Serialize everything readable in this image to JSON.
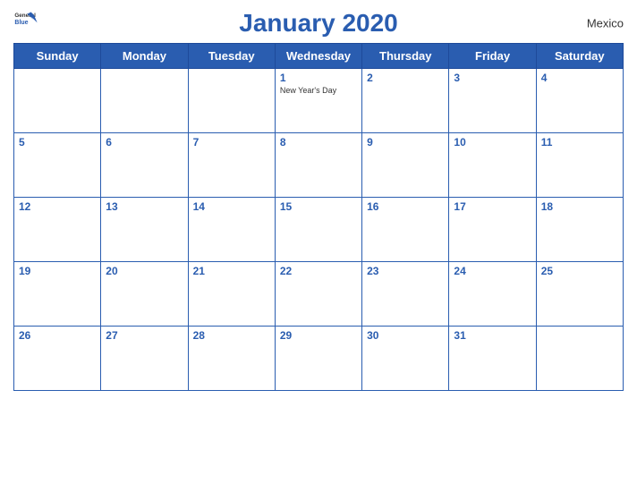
{
  "header": {
    "title": "January 2020",
    "country": "Mexico",
    "logo": {
      "line1": "General",
      "line2": "Blue"
    }
  },
  "weekdays": [
    "Sunday",
    "Monday",
    "Tuesday",
    "Wednesday",
    "Thursday",
    "Friday",
    "Saturday"
  ],
  "weeks": [
    [
      {
        "day": "",
        "holiday": ""
      },
      {
        "day": "",
        "holiday": ""
      },
      {
        "day": "",
        "holiday": ""
      },
      {
        "day": "1",
        "holiday": "New Year's Day"
      },
      {
        "day": "2",
        "holiday": ""
      },
      {
        "day": "3",
        "holiday": ""
      },
      {
        "day": "4",
        "holiday": ""
      }
    ],
    [
      {
        "day": "5",
        "holiday": ""
      },
      {
        "day": "6",
        "holiday": ""
      },
      {
        "day": "7",
        "holiday": ""
      },
      {
        "day": "8",
        "holiday": ""
      },
      {
        "day": "9",
        "holiday": ""
      },
      {
        "day": "10",
        "holiday": ""
      },
      {
        "day": "11",
        "holiday": ""
      }
    ],
    [
      {
        "day": "12",
        "holiday": ""
      },
      {
        "day": "13",
        "holiday": ""
      },
      {
        "day": "14",
        "holiday": ""
      },
      {
        "day": "15",
        "holiday": ""
      },
      {
        "day": "16",
        "holiday": ""
      },
      {
        "day": "17",
        "holiday": ""
      },
      {
        "day": "18",
        "holiday": ""
      }
    ],
    [
      {
        "day": "19",
        "holiday": ""
      },
      {
        "day": "20",
        "holiday": ""
      },
      {
        "day": "21",
        "holiday": ""
      },
      {
        "day": "22",
        "holiday": ""
      },
      {
        "day": "23",
        "holiday": ""
      },
      {
        "day": "24",
        "holiday": ""
      },
      {
        "day": "25",
        "holiday": ""
      }
    ],
    [
      {
        "day": "26",
        "holiday": ""
      },
      {
        "day": "27",
        "holiday": ""
      },
      {
        "day": "28",
        "holiday": ""
      },
      {
        "day": "29",
        "holiday": ""
      },
      {
        "day": "30",
        "holiday": ""
      },
      {
        "day": "31",
        "holiday": ""
      },
      {
        "day": "",
        "holiday": ""
      }
    ]
  ]
}
